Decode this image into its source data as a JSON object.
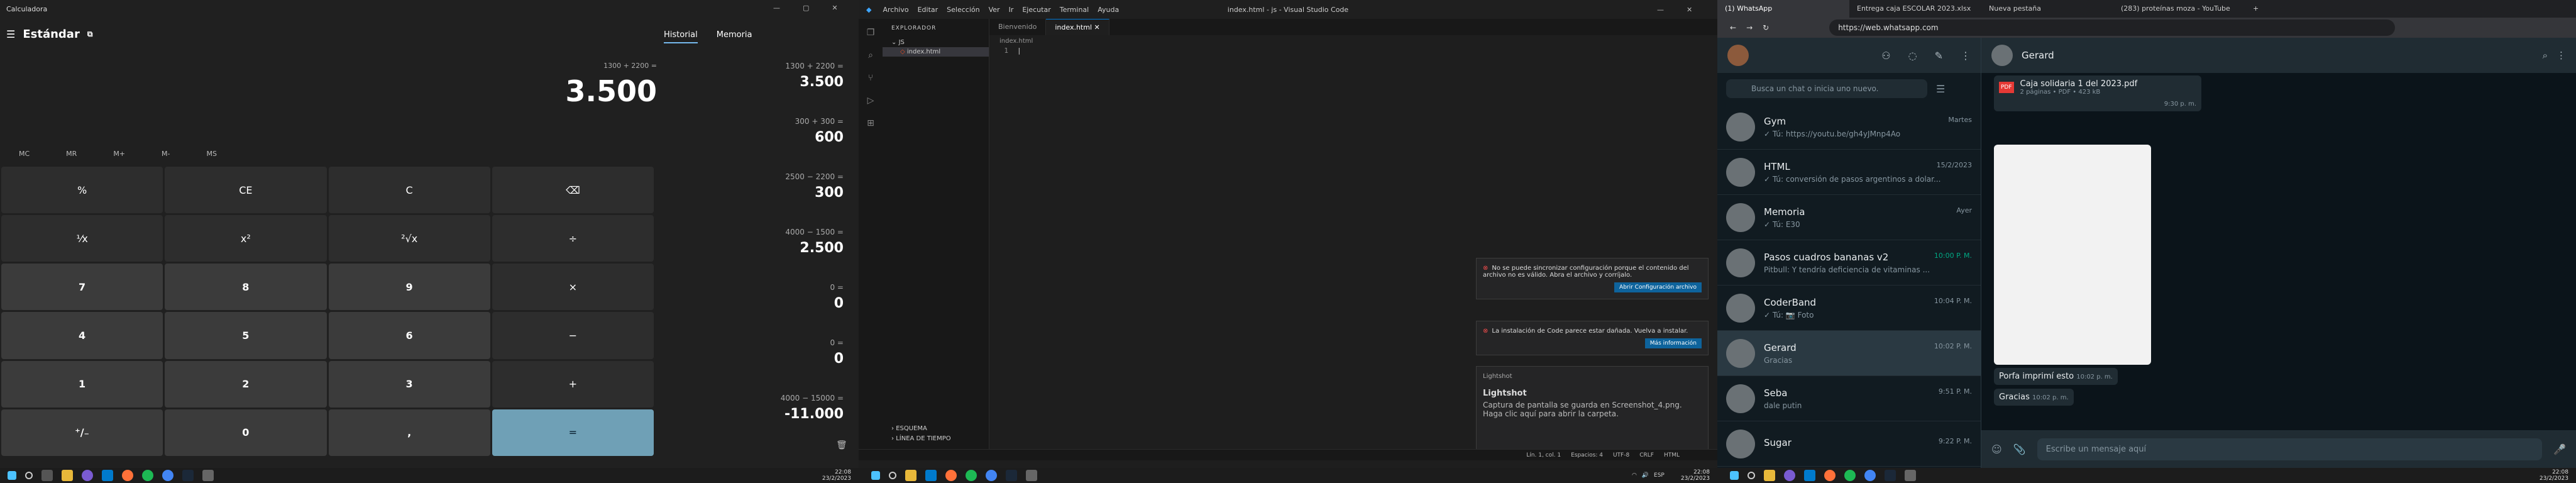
{
  "calculator": {
    "title": "Calculadora",
    "mode": "Estándar",
    "expression": "1300 + 2200 =",
    "display": "3.500",
    "memory_buttons": [
      "MC",
      "MR",
      "M+",
      "M-",
      "MS"
    ],
    "keys": [
      "%",
      "CE",
      "C",
      "⌫",
      "⅟x",
      "x²",
      "²√x",
      "÷",
      "7",
      "8",
      "9",
      "×",
      "4",
      "5",
      "6",
      "−",
      "1",
      "2",
      "3",
      "+",
      "⁺/₋",
      "0",
      ",",
      "="
    ],
    "history_tabs": [
      "Historial",
      "Memoria"
    ],
    "history": [
      {
        "expr": "1300 + 2200 =",
        "result": "3.500"
      },
      {
        "expr": "300 + 300 =",
        "result": "600"
      },
      {
        "expr": "2500 − 2200 =",
        "result": "300"
      },
      {
        "expr": "4000 − 1500 =",
        "result": "2.500"
      },
      {
        "expr": "0 =",
        "result": "0"
      },
      {
        "expr": "0 =",
        "result": "0"
      },
      {
        "expr": "4000 − 15000 =",
        "result": "-11.000"
      }
    ]
  },
  "taskbar1": {
    "time": "22:08",
    "date": "23/2/2023"
  },
  "vscode": {
    "menu": [
      "Archivo",
      "Editar",
      "Selección",
      "Ver",
      "Ir",
      "Ejecutar",
      "Terminal",
      "Ayuda"
    ],
    "window_title": "index.html - js - Visual Studio Code",
    "explorer_header": "EXPLORADOR",
    "folder": "JS",
    "file": "index.html",
    "tabs": [
      "Bienvenido",
      "index.html"
    ],
    "breadcrumb": "index.html",
    "line_number": "1",
    "outline": "ESQUEMA",
    "timeline": "LÍNEA DE TIEMPO",
    "toast1_text": "No se puede sincronizar configuración porque el contenido del archivo no es válido. Abra el archivo y corríjalo.",
    "toast1_btn": "Abrir Configuración archivo",
    "toast2_text": "La instalación de Code parece estar dañada. Vuelva a instalar.",
    "toast2_btn": "Más información",
    "lightshot_app": "Lightshot",
    "lightshot_title": "Lightshot",
    "lightshot_body": "Captura de pantalla se guarda en Screenshot_4.png. Haga clic aquí para abrir la carpeta.",
    "status": [
      "Lín. 1, col. 1",
      "Espacios: 4",
      "UTF-8",
      "CRLF",
      "HTML"
    ]
  },
  "taskbar2": {
    "time": "22:08",
    "date": "23/2/2023",
    "lang": "ESP"
  },
  "browser": {
    "tabs": [
      "(1) WhatsApp",
      "Entrega caja ESCOLAR 2023.xlsx",
      "Nueva pestaña",
      "(283) proteínas moza - YouTube"
    ],
    "url": "https://web.whatsapp.com"
  },
  "whatsapp": {
    "search_placeholder": "Busca un chat o inicia uno nuevo.",
    "chats": [
      {
        "name": "Gym",
        "time": "Martes",
        "msg": "✓ Tú: https://youtu.be/gh4yJMnp4Ao"
      },
      {
        "name": "HTML",
        "time": "15/2/2023",
        "msg": "✓ Tú: conversión de pasos argentinos a dolar..."
      },
      {
        "name": "Memoria",
        "time": "Ayer",
        "msg": "✓ Tú: E30"
      },
      {
        "name": "Pasos cuadros bananas v2",
        "time": "10:00 P. M.",
        "msg": "Pitbull: Y tendría deficiencia de vitaminas ..."
      },
      {
        "name": "CoderBand",
        "time": "10:04 P. M.",
        "msg": "✓ Tú: 📷 Foto"
      },
      {
        "name": "Gerard",
        "time": "10:02 P. M.",
        "msg": "Gracias"
      },
      {
        "name": "Seba",
        "time": "9:51 P. M.",
        "msg": "dale putin"
      },
      {
        "name": "Sugar",
        "time": "9:22 P. M.",
        "msg": ""
      }
    ],
    "contact": "Gerard",
    "doc_name": "Caja solidaria 1 del 2023.pdf",
    "doc_meta": "2 páginas • PDF • 423 kB",
    "doc_time": "9:30 p. m.",
    "msg1": "Porfa imprimí esto",
    "msg1_time": "10:02 p. m.",
    "msg2": "Gracias",
    "msg2_time": "10:02 p. m.",
    "input_placeholder": "Escribe un mensaje aquí"
  },
  "taskbar3": {
    "time": "22:08",
    "date": "23/2/2023"
  }
}
